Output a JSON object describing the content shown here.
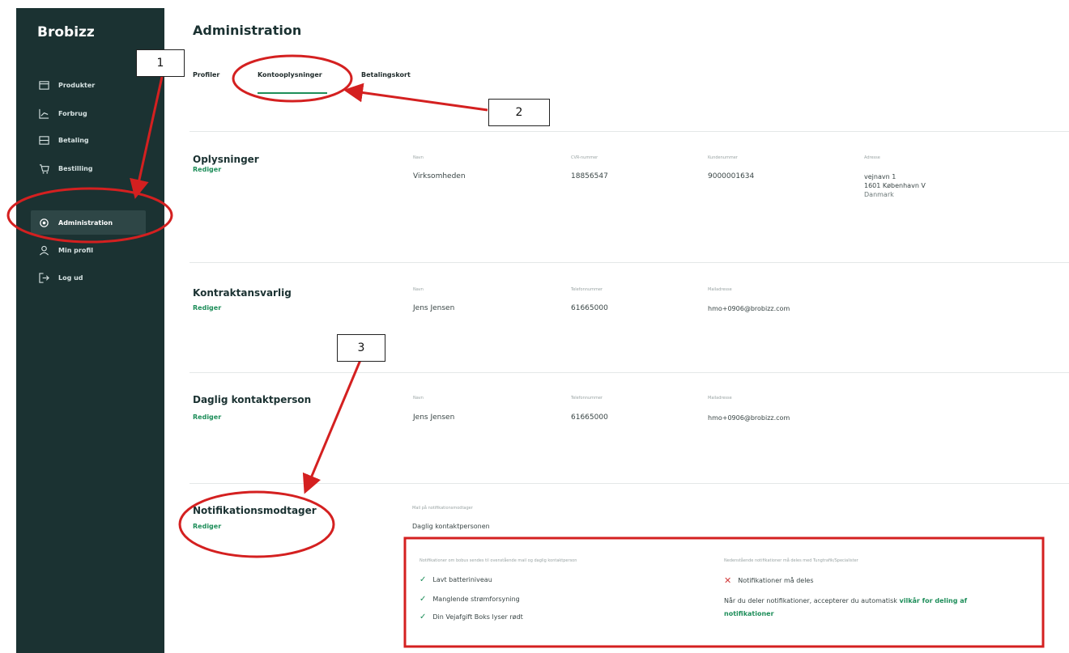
{
  "sidebar": {
    "brand": "Brobizz",
    "items": [
      {
        "label": "Produkter",
        "icon": "card-icon"
      },
      {
        "label": "Forbrug",
        "icon": "chart-icon"
      },
      {
        "label": "Betaling",
        "icon": "wallet-icon"
      },
      {
        "label": "Bestilling",
        "icon": "cart-icon"
      },
      {
        "label": "Administration",
        "icon": "gear-icon",
        "active": true
      },
      {
        "label": "Min profil",
        "icon": "user-icon"
      },
      {
        "label": "Log ud",
        "icon": "logout-icon"
      }
    ]
  },
  "header": {
    "title": "Administration"
  },
  "tabs": [
    {
      "label": "Profiler"
    },
    {
      "label": "Kontooplysninger",
      "active": true
    },
    {
      "label": "Betalingskort"
    }
  ],
  "sections": {
    "oplysninger": {
      "title": "Oplysninger",
      "edit": "Rediger",
      "fields": [
        {
          "label": "Navn",
          "value": "Virksomheden"
        },
        {
          "label": "CVR-nummer",
          "value": "18856547"
        },
        {
          "label": "Kundenummer",
          "value": "9000001634"
        },
        {
          "label": "Adresse",
          "lines": [
            "vejnavn 1",
            "1601 København V",
            "Danmark"
          ]
        }
      ]
    },
    "kontraktansvarlig": {
      "title": "Kontraktansvarlig",
      "edit": "Rediger",
      "fields": [
        {
          "label": "Navn",
          "value": "Jens Jensen"
        },
        {
          "label": "Telefonnummer",
          "value": "61665000"
        },
        {
          "label": "Mailadresse",
          "value": "hmo+0906@brobizz.com"
        }
      ]
    },
    "daglig": {
      "title": "Daglig kontaktperson",
      "edit": "Rediger",
      "fields": [
        {
          "label": "Navn",
          "value": "Jens Jensen"
        },
        {
          "label": "Telefonnummer",
          "value": "61665000"
        },
        {
          "label": "Mailadresse",
          "value": "hmo+0906@brobizz.com"
        }
      ]
    },
    "notifikation": {
      "title": "Notifikationsmodtager",
      "edit": "Rediger",
      "mail_label": "Mail på notifikationsmodtager",
      "mail_value": "Daglig kontaktpersonen",
      "left_label": "Notifikationer om bobus sendes til ovenstående mail og daglig kontaktperson",
      "checks": [
        "Lavt batteriniveau",
        "Manglende strømforsyning",
        "Din Vejafgift Boks lyser rødt"
      ],
      "right_label": "Nedenstående notifikationer må deles med Tungtrafik/Specialister",
      "cross": "Notifikationer må deles",
      "consent_text": "Når du deler notifikationer, accepterer du automatisk",
      "consent_link": "vilkår for deling af notifikationer"
    }
  },
  "annotations": [
    "1",
    "2",
    "3"
  ],
  "colors": {
    "sidebar": "#1b3232",
    "accent": "#1e8e5a",
    "annotation": "#d42020"
  }
}
